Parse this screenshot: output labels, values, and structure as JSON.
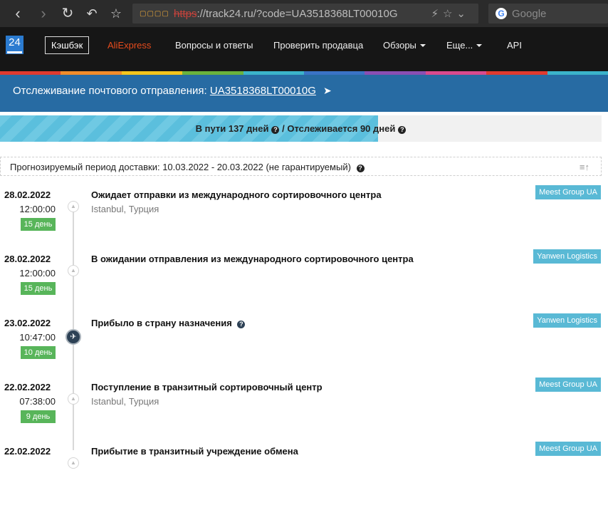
{
  "browser": {
    "url_lock": "▢▢▢▢",
    "url_protocol": "https",
    "url_rest": "://track24.ru/?code=UA3518368LT00010G",
    "search_placeholder": "Google",
    "google_letter": "G"
  },
  "site_nav": {
    "logo_text": "24",
    "cashback_label": "Кэшбэк",
    "links": [
      "AliExpress",
      "Вопросы и ответы",
      "Проверить продавца",
      "Обзоры",
      "Еще...",
      "API"
    ]
  },
  "stripe_colors": [
    "#e03a2f",
    "#f08c2a",
    "#f4c51d",
    "#6ab23d",
    "#3bb3c9",
    "#3a73c5",
    "#8a4fb3",
    "#d94a8e",
    "#e03a2f",
    "#3bb3c9"
  ],
  "tracking": {
    "title_prefix": "Отслеживание почтового отправления:",
    "number": "UA3518368LT00010G"
  },
  "progress": {
    "text": "В пути 137 дней",
    "separator": "/ Отслеживается 90 дней",
    "fill_percent": 62.8
  },
  "forecast": {
    "text": "Прогнозируемый период доставки: 10.03.2022 - 20.03.2022 (не гарантируемый)"
  },
  "events": [
    {
      "date": "28.02.2022",
      "time": "12:00:00",
      "days": "15 день",
      "title": "Ожидает отправки из международного сортировочного центра",
      "location": "Istanbul, Турция",
      "service": "Meest Group UA",
      "marker": "up"
    },
    {
      "date": "28.02.2022",
      "time": "12:00:00",
      "days": "15 день",
      "title": "В ожидании отправления из международного сортировочного центра",
      "location": "",
      "service": "Yanwen Logistics",
      "marker": "up"
    },
    {
      "date": "23.02.2022",
      "time": "10:47:00",
      "days": "10 день",
      "title": "Прибыло в страну назначения",
      "location": "",
      "service": "Yanwen Logistics",
      "marker": "plane"
    },
    {
      "date": "22.02.2022",
      "time": "07:38:00",
      "days": "9 день",
      "title": "Поступление в транзитный сортировочный центр",
      "location": "Istanbul, Турция",
      "service": "Meest Group UA",
      "marker": "up"
    },
    {
      "date": "22.02.2022",
      "time": "",
      "days": "",
      "title": "Прибытие в транзитный учреждение обмена",
      "location": "",
      "service": "Meest Group UA",
      "marker": "up"
    }
  ]
}
